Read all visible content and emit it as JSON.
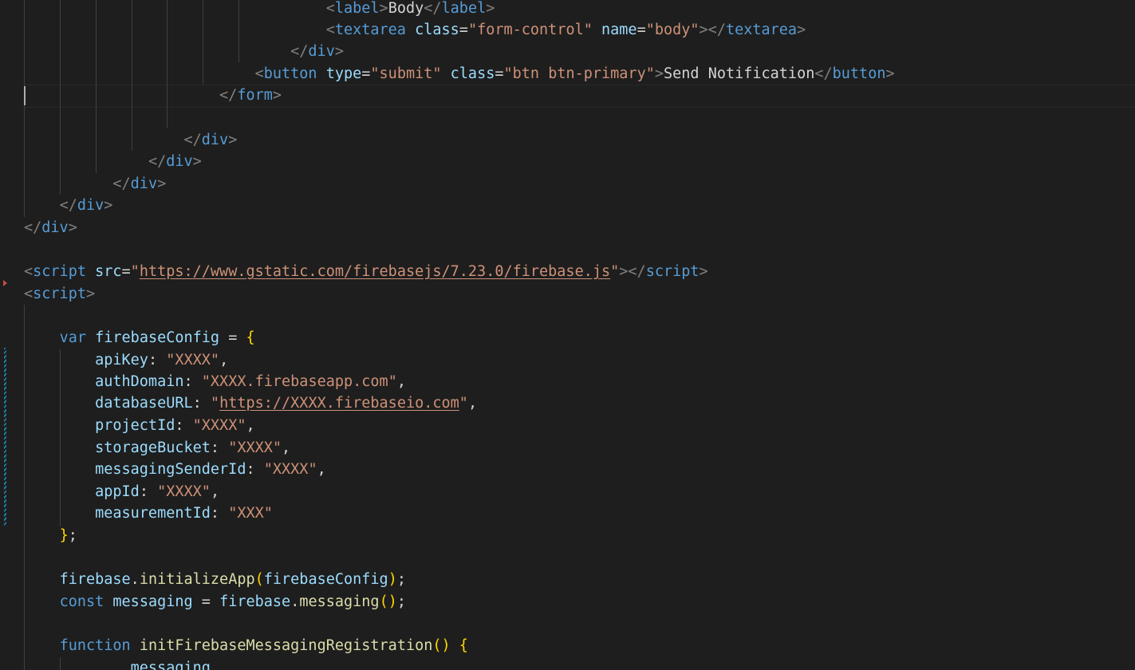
{
  "editor": {
    "colors": {
      "background": "#1e1e1e",
      "tag": "#569cd6",
      "attribute": "#9cdcfe",
      "string": "#ce9178",
      "function": "#dcdcaa",
      "bracket": "#ffd700"
    },
    "icons": {
      "fold": "fold-arrow-icon",
      "modified": "modified-lines-indicator"
    },
    "code": {
      "l1_tag": "label",
      "l1_text": "Body",
      "l2_tag": "textarea",
      "l2_attr1": "class",
      "l2_val1": "\"form-control\"",
      "l2_attr2": "name",
      "l2_val2": "\"body\"",
      "l3_tag": "div",
      "l4_tag": "button",
      "l4_attr1": "type",
      "l4_val1": "\"submit\"",
      "l4_attr2": "class",
      "l4_val2": "\"btn btn-primary\"",
      "l4_text": "Send Notification",
      "l5_tag": "form",
      "l6_tag": "div",
      "l7_tag": "div",
      "l8_tag": "div",
      "l9_tag": "div",
      "l10_tag": "div",
      "l11_tag": "script",
      "l11_attr": "src",
      "l11_url": "https://www.gstatic.com/firebasejs/7.23.0/firebase.js",
      "l12_tag": "script",
      "l13_kw": "var",
      "l13_var": "firebaseConfig",
      "cfg": [
        {
          "key": "apiKey",
          "q1": "\"",
          "val": "XXXX",
          "q2": "\"",
          "comma": ","
        },
        {
          "key": "authDomain",
          "q1": "\"",
          "val": "XXXX.firebaseapp.com",
          "q2": "\"",
          "comma": ","
        },
        {
          "key": "databaseURL",
          "q1": "\"",
          "val": "https://XXXX.firebaseio.com",
          "q2": "\"",
          "comma": ","
        },
        {
          "key": "projectId",
          "q1": "\"",
          "val": "XXXX",
          "q2": "\"",
          "comma": ","
        },
        {
          "key": "storageBucket",
          "q1": "\"",
          "val": "XXXX",
          "q2": "\"",
          "comma": ","
        },
        {
          "key": "messagingSenderId",
          "q1": "\"",
          "val": "XXXX",
          "q2": "\"",
          "comma": ","
        },
        {
          "key": "appId",
          "q1": "\"",
          "val": "XXXX",
          "q2": "\"",
          "comma": ","
        },
        {
          "key": "measurementId",
          "q1": "\"",
          "val": "XXX",
          "q2": "\"",
          "comma": ""
        }
      ],
      "l22_obj": "firebase",
      "l22_fn": "initializeApp",
      "l22_arg": "firebaseConfig",
      "l23_kw": "const",
      "l23_var": "messaging",
      "l23_obj": "firebase",
      "l23_fn": "messaging",
      "l24_kw": "function",
      "l24_fn": "initFirebaseMessagingRegistration",
      "l25_var": "messaging"
    }
  }
}
